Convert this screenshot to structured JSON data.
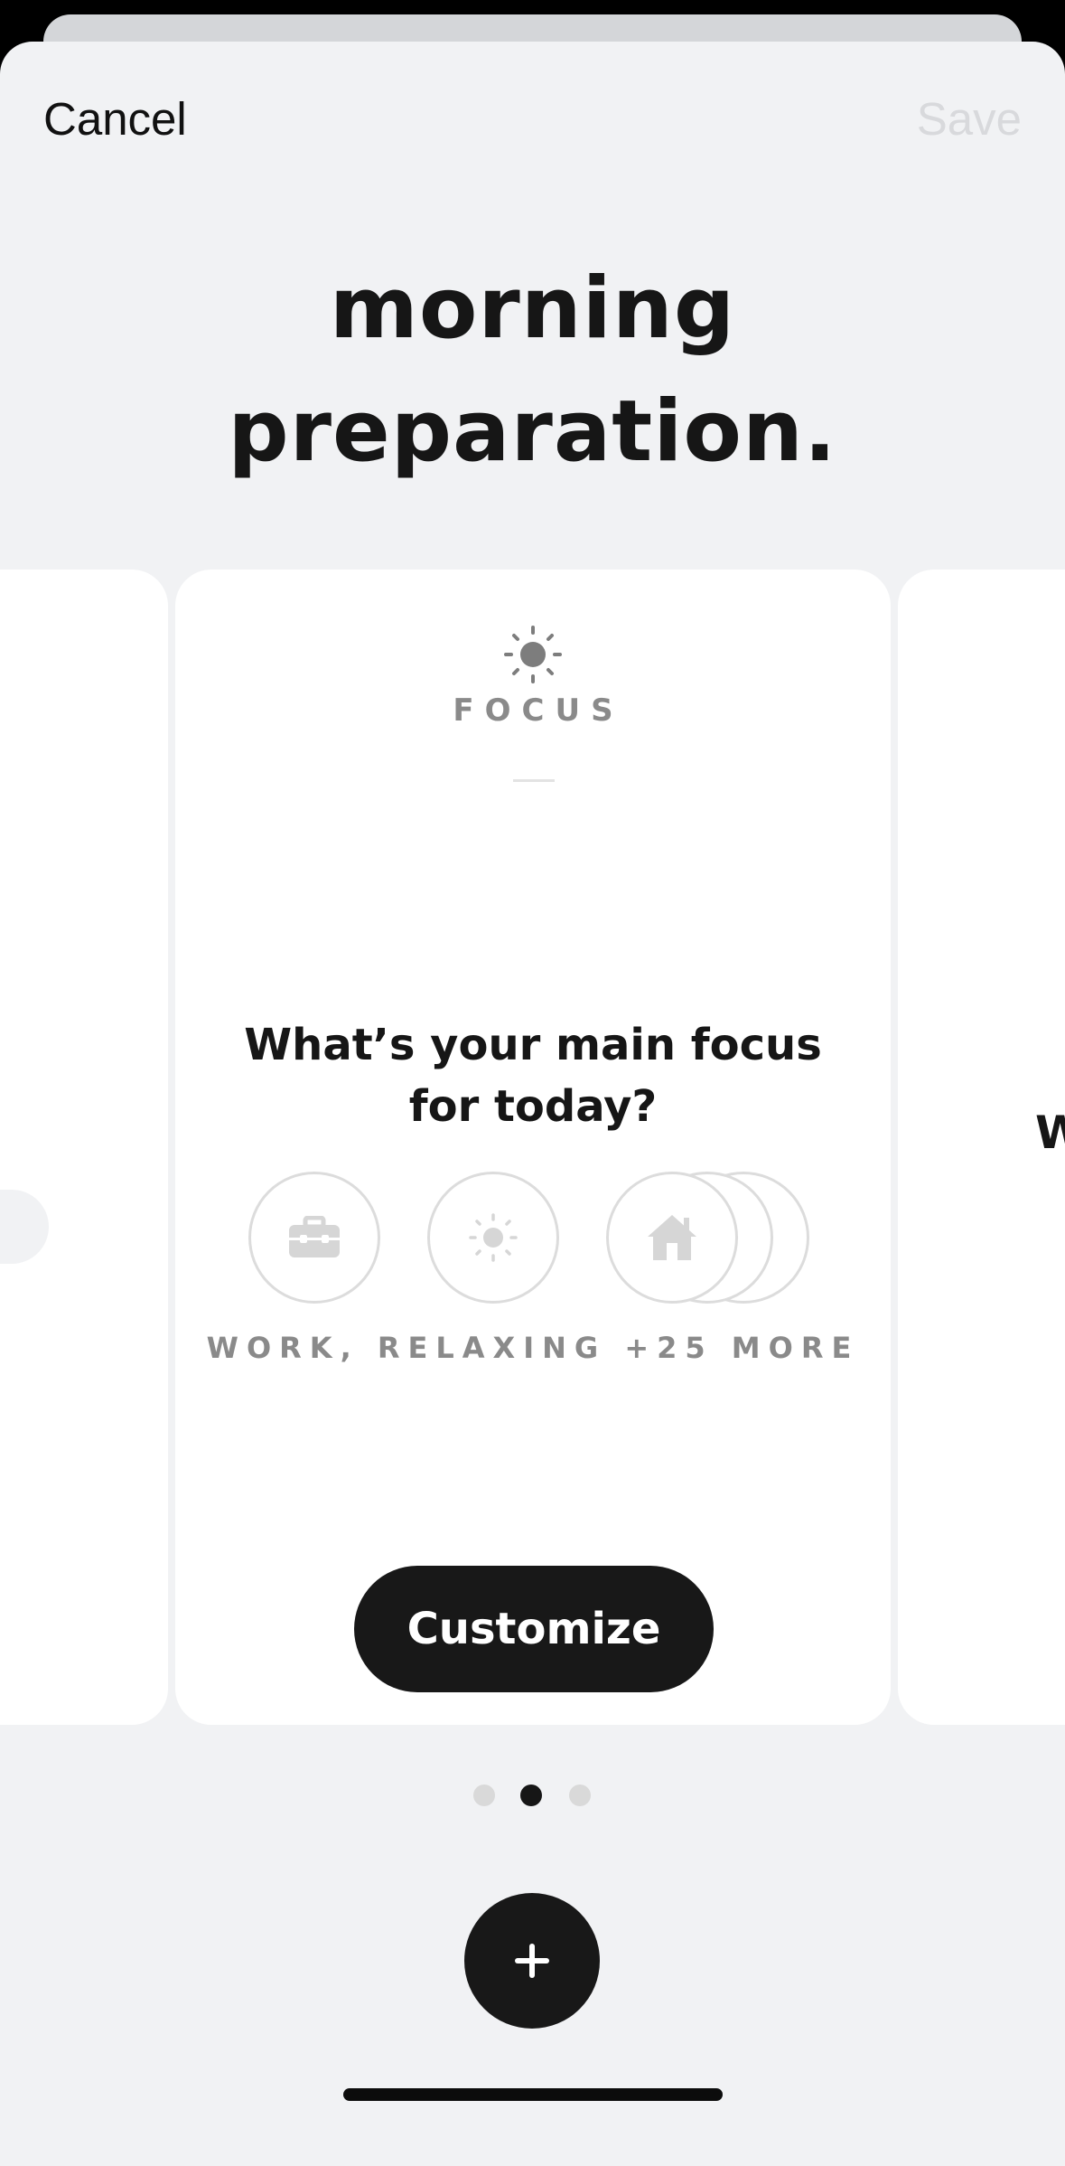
{
  "header": {
    "cancel_label": "Cancel",
    "save_label": "Save"
  },
  "routine_title": {
    "line1": "morning",
    "line2": "preparation."
  },
  "card": {
    "icon": "sun-icon",
    "category_label": "FOCUS",
    "question": {
      "line1": "What’s your main focus",
      "line2": "for today?"
    },
    "selected_icons": [
      "briefcase-icon",
      "sun-icon",
      "house-icon"
    ],
    "summary": "WORK, RELAXING +25 MORE",
    "action_label": "Customize"
  },
  "next_card_peek": "W",
  "pagination": {
    "total": 3,
    "active_index": 1
  },
  "add_button": "plus-icon",
  "colors": {
    "background": "#f1f2f4",
    "card": "#ffffff",
    "primary": "#181818",
    "muted": "#8a8a8a"
  }
}
